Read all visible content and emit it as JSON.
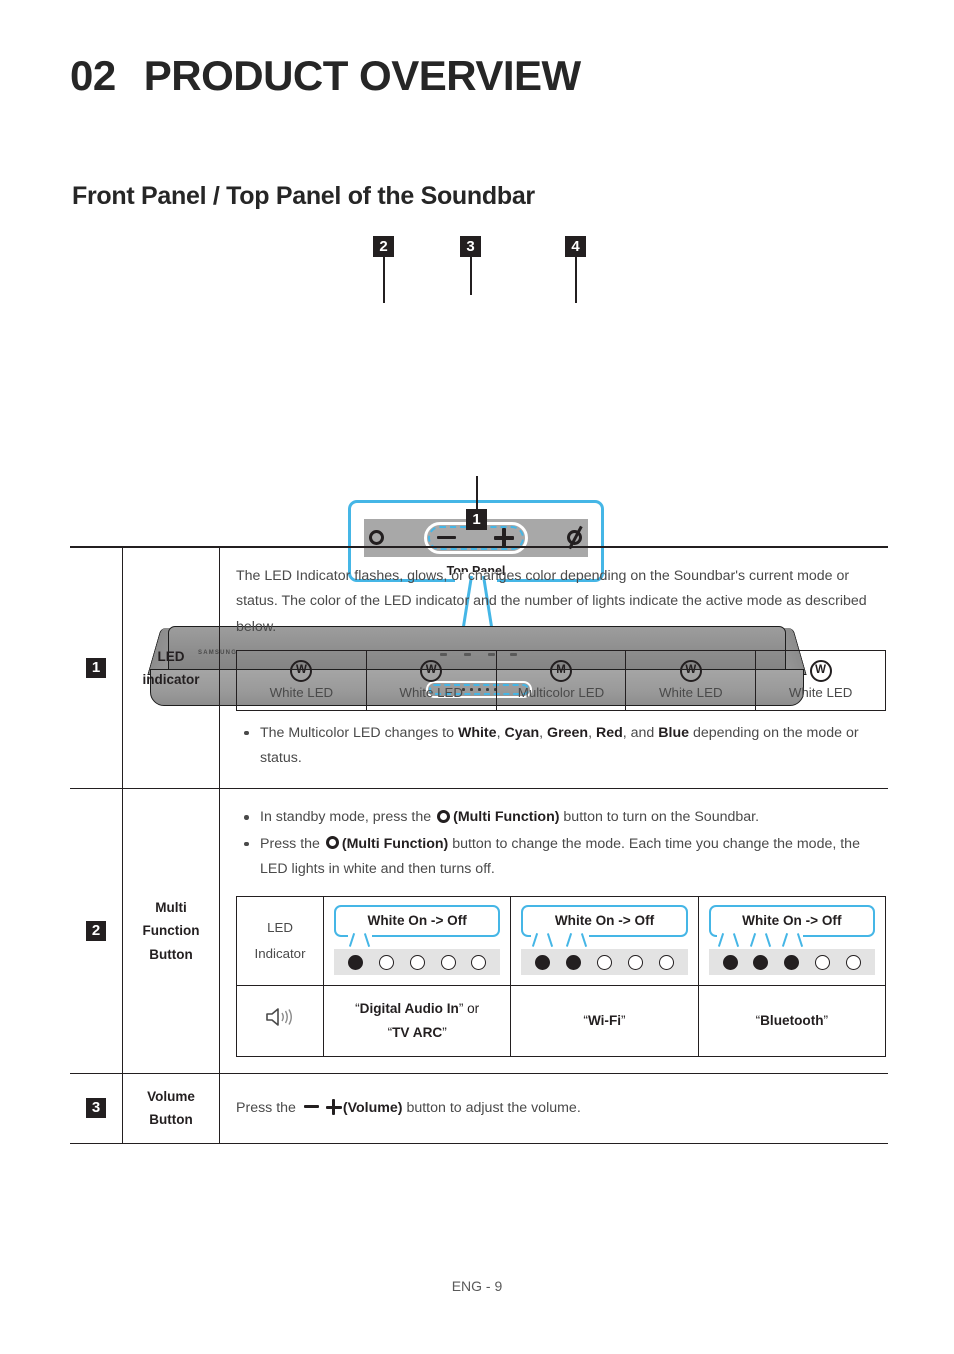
{
  "header": {
    "chapter_number": "02",
    "chapter_title": "PRODUCT OVERVIEW",
    "section_title": "Front Panel / Top Panel of the Soundbar"
  },
  "figure": {
    "top_panel_label": "Top Panel",
    "callout_2": "2",
    "callout_3": "3",
    "callout_4": "4",
    "callout_1": "1",
    "brand_logo": "SAMSUNG",
    "icons": {
      "multi_function": "circle-icon",
      "volume_down": "minus-icon",
      "volume_up": "plus-icon",
      "mic_off": "slashed-circle-icon"
    },
    "accent_color": "#45b6e6",
    "soundbar_color": "#9a9a9a"
  },
  "table": {
    "rows": [
      {
        "number": "1",
        "name": "LED\nindicator",
        "name_line1": "LED",
        "name_line2": "indicator",
        "paragraph": "The LED Indicator flashes, glows, or changes color depending on the Soundbar's current mode or status. The color of the LED indicator and the number of lights indicate the active mode as described below.",
        "led_table": [
          {
            "badge": "W",
            "caption": "White LED"
          },
          {
            "badge": "W",
            "caption": "White LED"
          },
          {
            "badge": "M",
            "caption": "Multicolor LED"
          },
          {
            "badge": "W",
            "caption": "White LED"
          },
          {
            "badge": "W",
            "caption": "White LED"
          }
        ],
        "bullet_prefix": "The Multicolor LED changes to ",
        "bullet_colors": [
          "White",
          "Cyan",
          "Green",
          "Red",
          "Blue"
        ],
        "bullet_suffix": " depending on the mode or status."
      },
      {
        "number": "2",
        "name_line1": "Multi",
        "name_line2": "Function",
        "name_line3": "Button",
        "bullet1_a": "In standby mode, press the ",
        "bullet1_b": "(Multi Function)",
        "bullet1_c": " button to turn on the Soundbar.",
        "bullet2_a": "Press the ",
        "bullet2_b": "(Multi Function)",
        "bullet2_c": " button to change the mode. Each time you change the mode, the LED lights in white and then turns off.",
        "mode_table": {
          "row_label_line1": "LED",
          "row_label_line2": "Indicator",
          "speaker_icon": "speaker-icon",
          "columns": [
            {
              "bubble": "White On -> Off",
              "dots": [
                true,
                false,
                false,
                false,
                false
              ],
              "mode_prefix": "“",
              "mode_bold": "Digital Audio In",
              "mode_mid": "” or",
              "mode_bold2": "TV ARC",
              "mode_label": "“Digital Audio In” or “TV ARC”"
            },
            {
              "bubble": "White On -> Off",
              "dots": [
                true,
                true,
                false,
                false,
                false
              ],
              "mode_label": "“Wi-Fi”",
              "mode_bold": "Wi-Fi"
            },
            {
              "bubble": "White On -> Off",
              "dots": [
                true,
                true,
                true,
                false,
                false
              ],
              "mode_label": "“Bluetooth”",
              "mode_bold": "Bluetooth"
            }
          ]
        }
      },
      {
        "number": "3",
        "name_line1": "Volume",
        "name_line2": "Button",
        "body_a": "Press the ",
        "body_b": "(Volume)",
        "body_c": " button to adjust the volume."
      }
    ]
  },
  "footer": {
    "page_label": "ENG - 9"
  }
}
